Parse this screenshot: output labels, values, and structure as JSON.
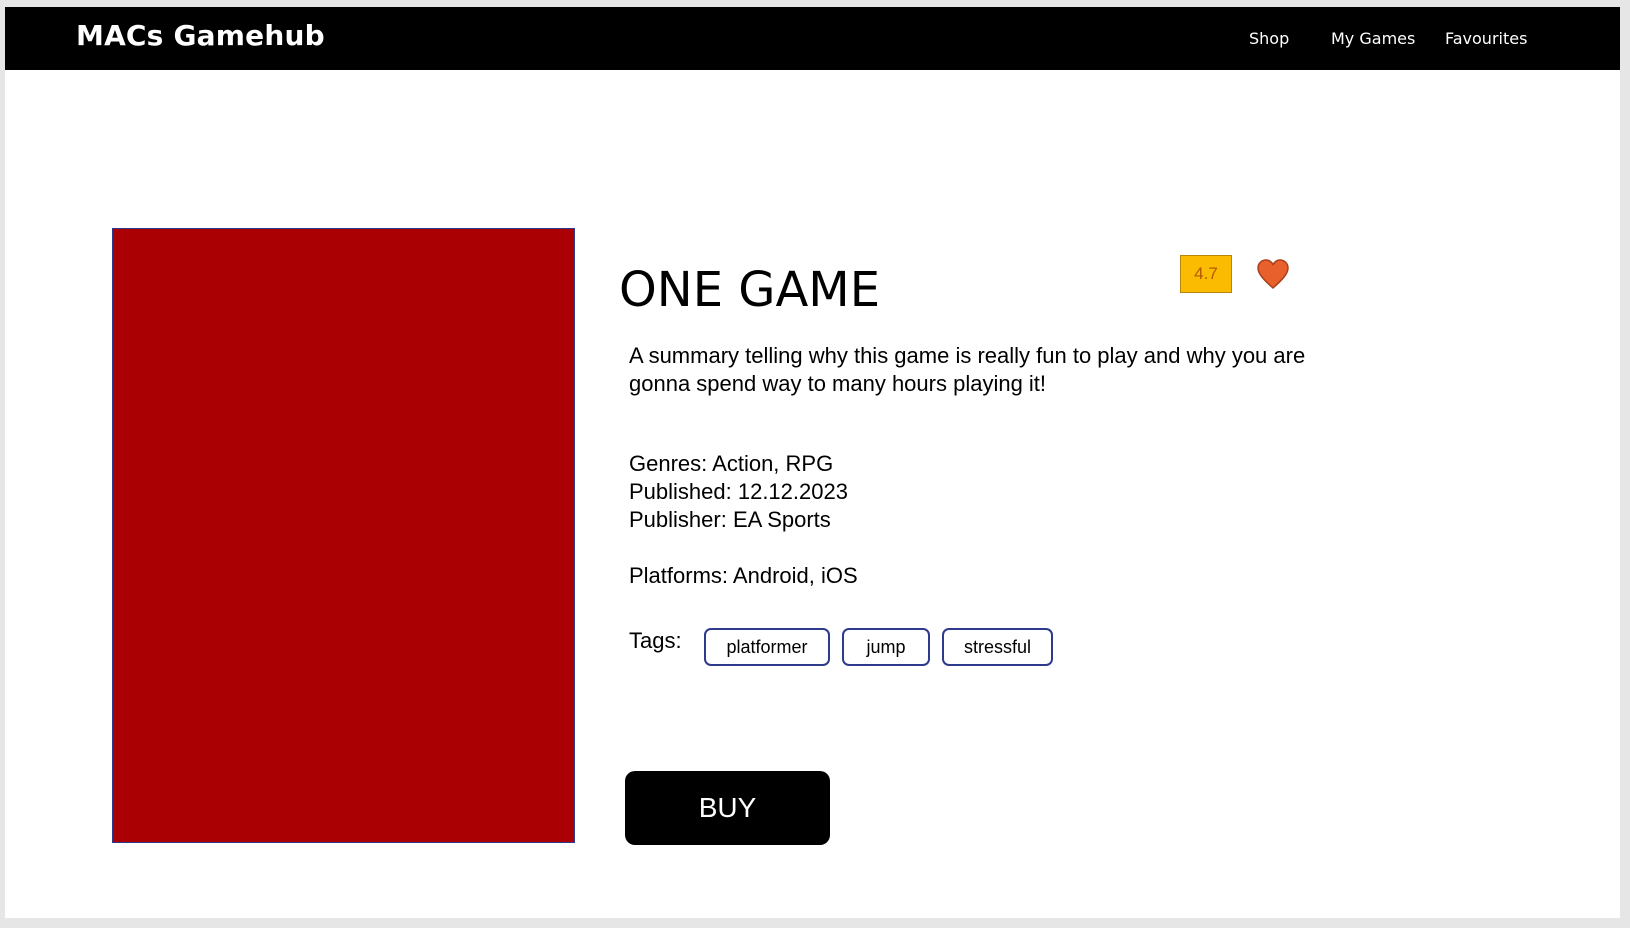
{
  "header": {
    "brand": "MACs Gamehub",
    "nav": [
      "Shop",
      "My Games",
      "Favourites"
    ]
  },
  "game": {
    "title": "ONE GAME",
    "rating": "4.7",
    "favourite_icon": "heart-icon",
    "summary": "A summary telling why this game is really fun to play and why you are gonna spend way to many hours playing it!",
    "genres": "Genres: Action, RPG",
    "published": "Published: 12.12.2023",
    "publisher": "Publisher: EA Sports",
    "platforms": "Platforms: Android, iOS",
    "tags_label": "Tags:",
    "tags": [
      "platformer",
      "jump",
      "stressful"
    ],
    "buy_label": "BUY"
  },
  "colors": {
    "navbar": "#000000",
    "cover": "#ab0003",
    "rating_bg": "#fbbb00",
    "heart": "#e8612c",
    "tag_border": "#2e3a8c",
    "buy_bg": "#000000"
  }
}
